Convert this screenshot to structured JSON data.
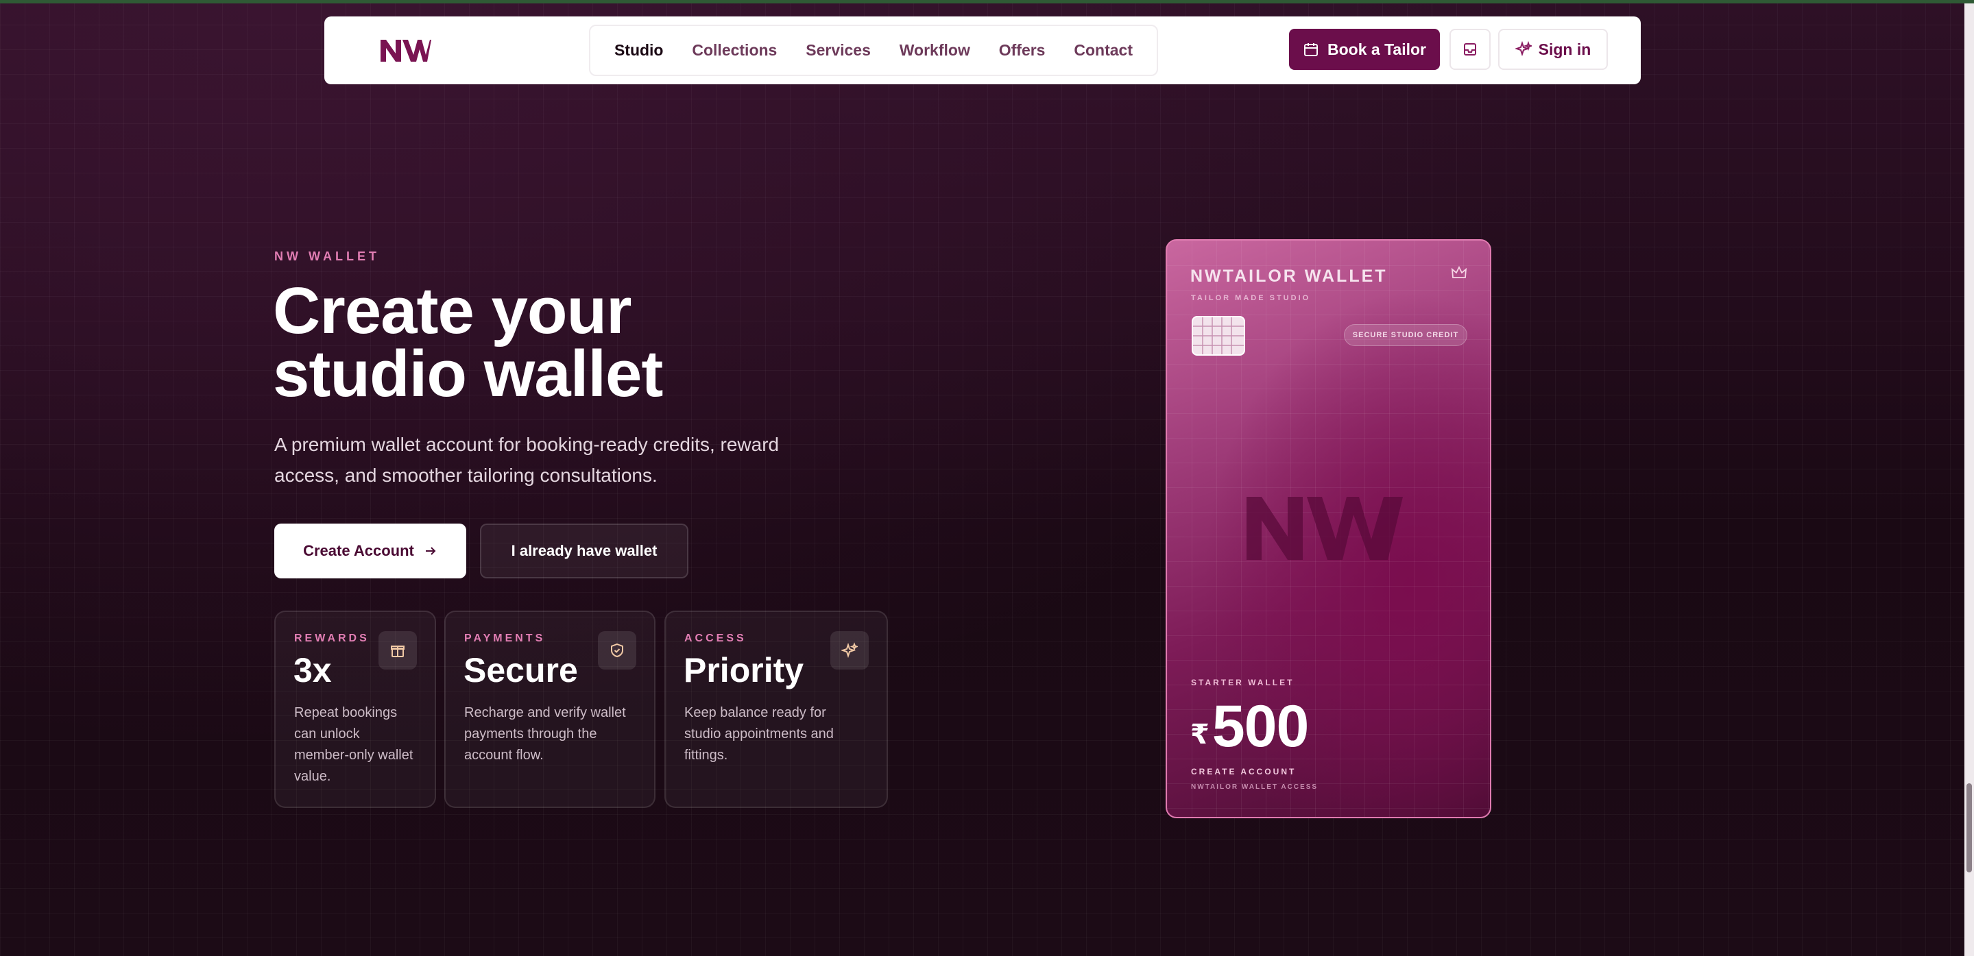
{
  "nav": {
    "logo_alt": "NW",
    "links": [
      "Studio",
      "Collections",
      "Services",
      "Workflow",
      "Offers",
      "Contact"
    ],
    "active_link": "Studio",
    "book_label": "Book a Tailor",
    "signin_label": "Sign in"
  },
  "hero": {
    "eyebrow": "NW WALLET",
    "title_line1": "Create your",
    "title_line2": "studio wallet",
    "subtitle": "A premium wallet account for booking-ready credits, reward access, and smoother tailoring consultations.",
    "primary_cta": "Create Account",
    "secondary_cta": "I already have wallet"
  },
  "stats": [
    {
      "label": "REWARDS",
      "value": "3x",
      "description": "Repeat bookings can unlock member-only wallet value.",
      "icon": "gift-icon"
    },
    {
      "label": "PAYMENTS",
      "value": "Secure",
      "description": "Recharge and verify wallet payments through the account flow.",
      "icon": "shield-icon"
    },
    {
      "label": "ACCESS",
      "value": "Priority",
      "description": "Keep balance ready for studio appointments and fittings.",
      "icon": "sparkle-icon"
    }
  ],
  "wallet": {
    "title": "NWTAILOR WALLET",
    "subtitle": "TAILOR MADE STUDIO",
    "badge": "SECURE STUDIO CREDIT",
    "tier": "STARTER WALLET",
    "currency": "₹",
    "amount": "500",
    "cta": "CREATE ACCOUNT",
    "footer": "NWTAILOR WALLET ACCESS"
  },
  "colors": {
    "brand": "#6b0e4b",
    "accent_pink": "#e27eb4",
    "background": "#1c0a16"
  }
}
